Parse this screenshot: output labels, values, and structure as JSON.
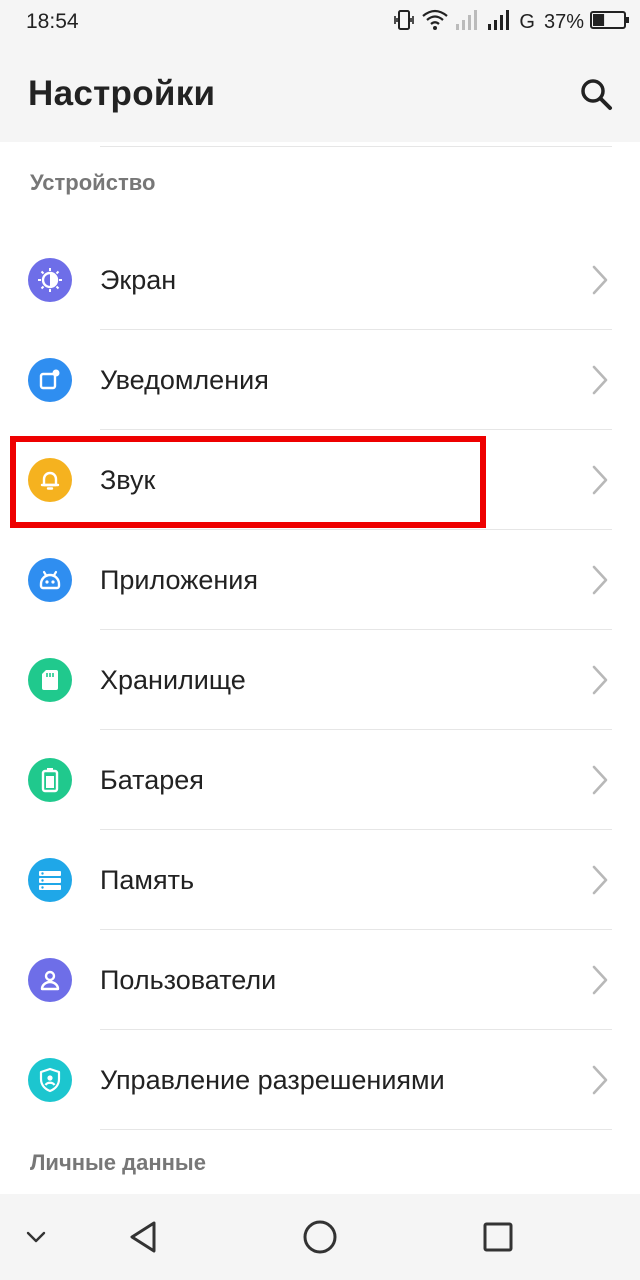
{
  "status_bar": {
    "time": "18:54",
    "network_label": "G",
    "battery_percent": "37%",
    "battery_level": 0.37,
    "icons": [
      "vibrate-icon",
      "wifi-icon",
      "signal-sim1-icon",
      "signal-sim2-icon",
      "battery-icon"
    ]
  },
  "app_bar": {
    "title": "Настройки",
    "search_icon": "search-icon"
  },
  "sections": {
    "device": "Устройство",
    "personal": "Личные данные"
  },
  "items": [
    {
      "label": "Экран",
      "icon": "display-brightness-icon",
      "color": "#6e6ee8"
    },
    {
      "label": "Уведомления",
      "icon": "notification-icon",
      "color": "#2f8ef0"
    },
    {
      "label": "Звук",
      "icon": "bell-icon",
      "color": "#f5b21f"
    },
    {
      "label": "Приложения",
      "icon": "android-apps-icon",
      "color": "#2f8ef0"
    },
    {
      "label": "Хранилище",
      "icon": "sd-card-icon",
      "color": "#20c98d"
    },
    {
      "label": "Батарея",
      "icon": "battery-icon",
      "color": "#20c98d"
    },
    {
      "label": "Память",
      "icon": "memory-icon",
      "color": "#1fa7e8"
    },
    {
      "label": "Пользователи",
      "icon": "user-icon",
      "color": "#6e6ee8"
    },
    {
      "label": "Управление разрешениями",
      "icon": "shield-user-icon",
      "color": "#1cc6cf"
    }
  ],
  "highlighted_item": "Звук",
  "highlight_color": "#ee0000",
  "nav_bar": [
    "collapse-chevron-icon",
    "back-icon",
    "home-icon",
    "recents-icon"
  ]
}
